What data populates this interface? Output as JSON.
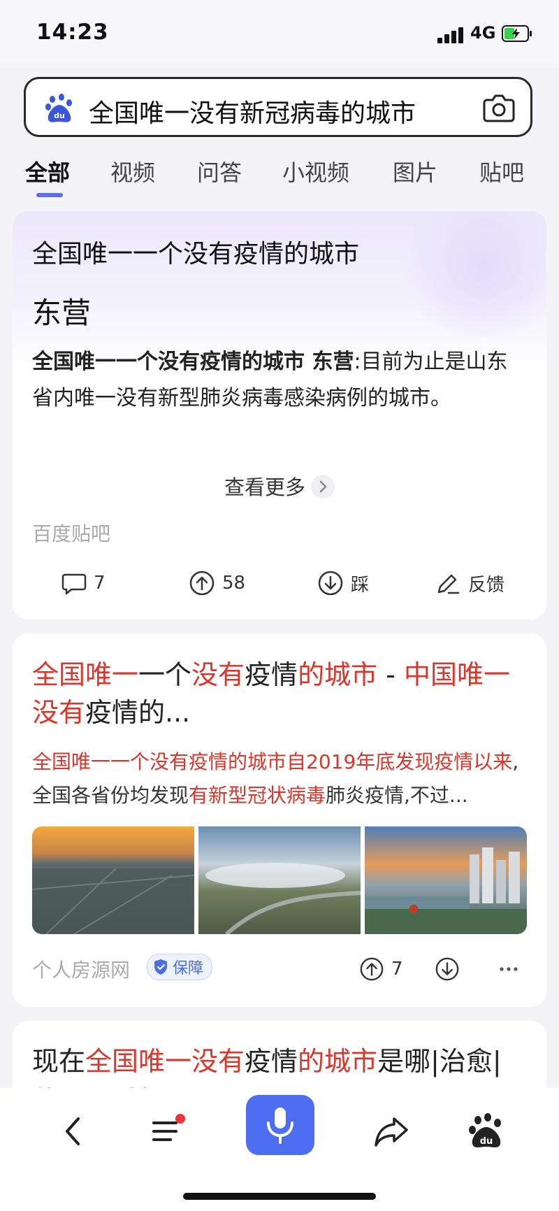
{
  "status_bar": {
    "time": "14:23",
    "network": "4G"
  },
  "search": {
    "query": "全国唯一没有新冠病毒的城市"
  },
  "tabs": [
    {
      "label": "全部",
      "active": true
    },
    {
      "label": "视频"
    },
    {
      "label": "问答"
    },
    {
      "label": "小视频"
    },
    {
      "label": "图片"
    },
    {
      "label": "贴吧"
    }
  ],
  "answer_card": {
    "title": "全国唯一一个没有疫情的城市",
    "answer": "东营",
    "body_bold": "全国唯一一个没有疫情的城市 东营",
    "body_rest": ":目前为止是山东省内唯一没有新型肺炎病毒感染病例的城市。",
    "more_label": "查看更多",
    "source": "百度贴吧",
    "comments": "7",
    "upvotes": "58",
    "downvote_label": "踩",
    "feedback_label": "反馈"
  },
  "result_2": {
    "title_parts": [
      "全国唯一",
      "一个",
      "没有",
      "疫情",
      "的城市",
      " - ",
      "中国唯一没有",
      "疫情的..."
    ],
    "snippet_red": "全国唯一一个没有疫情的城市自2019年底发现疫情以来",
    "snippet_mid": ",全国各省份均发现",
    "snippet_red2": "有新型冠状病毒",
    "snippet_end": "肺炎疫情,不过...",
    "source": "个人房源网",
    "badge": "保障",
    "upvotes": "7"
  },
  "result_3": {
    "title_parts": [
      "现在",
      "全国唯一没有",
      "疫情",
      "的城市",
      "是哪|治愈|"
    ],
    "title_line2": "值……手机网易网"
  },
  "colors": {
    "accent": "#4e6ef2",
    "highlight": "#d7372c",
    "tab_indicator": "#5b6cf0"
  },
  "icons": [
    "baidu-logo-icon",
    "camera-icon",
    "comment-icon",
    "upvote-icon",
    "downvote-icon",
    "edit-icon",
    "shield-icon",
    "more-icon",
    "back-icon",
    "menu-icon",
    "mic-icon",
    "share-icon",
    "baidu-home-icon"
  ]
}
